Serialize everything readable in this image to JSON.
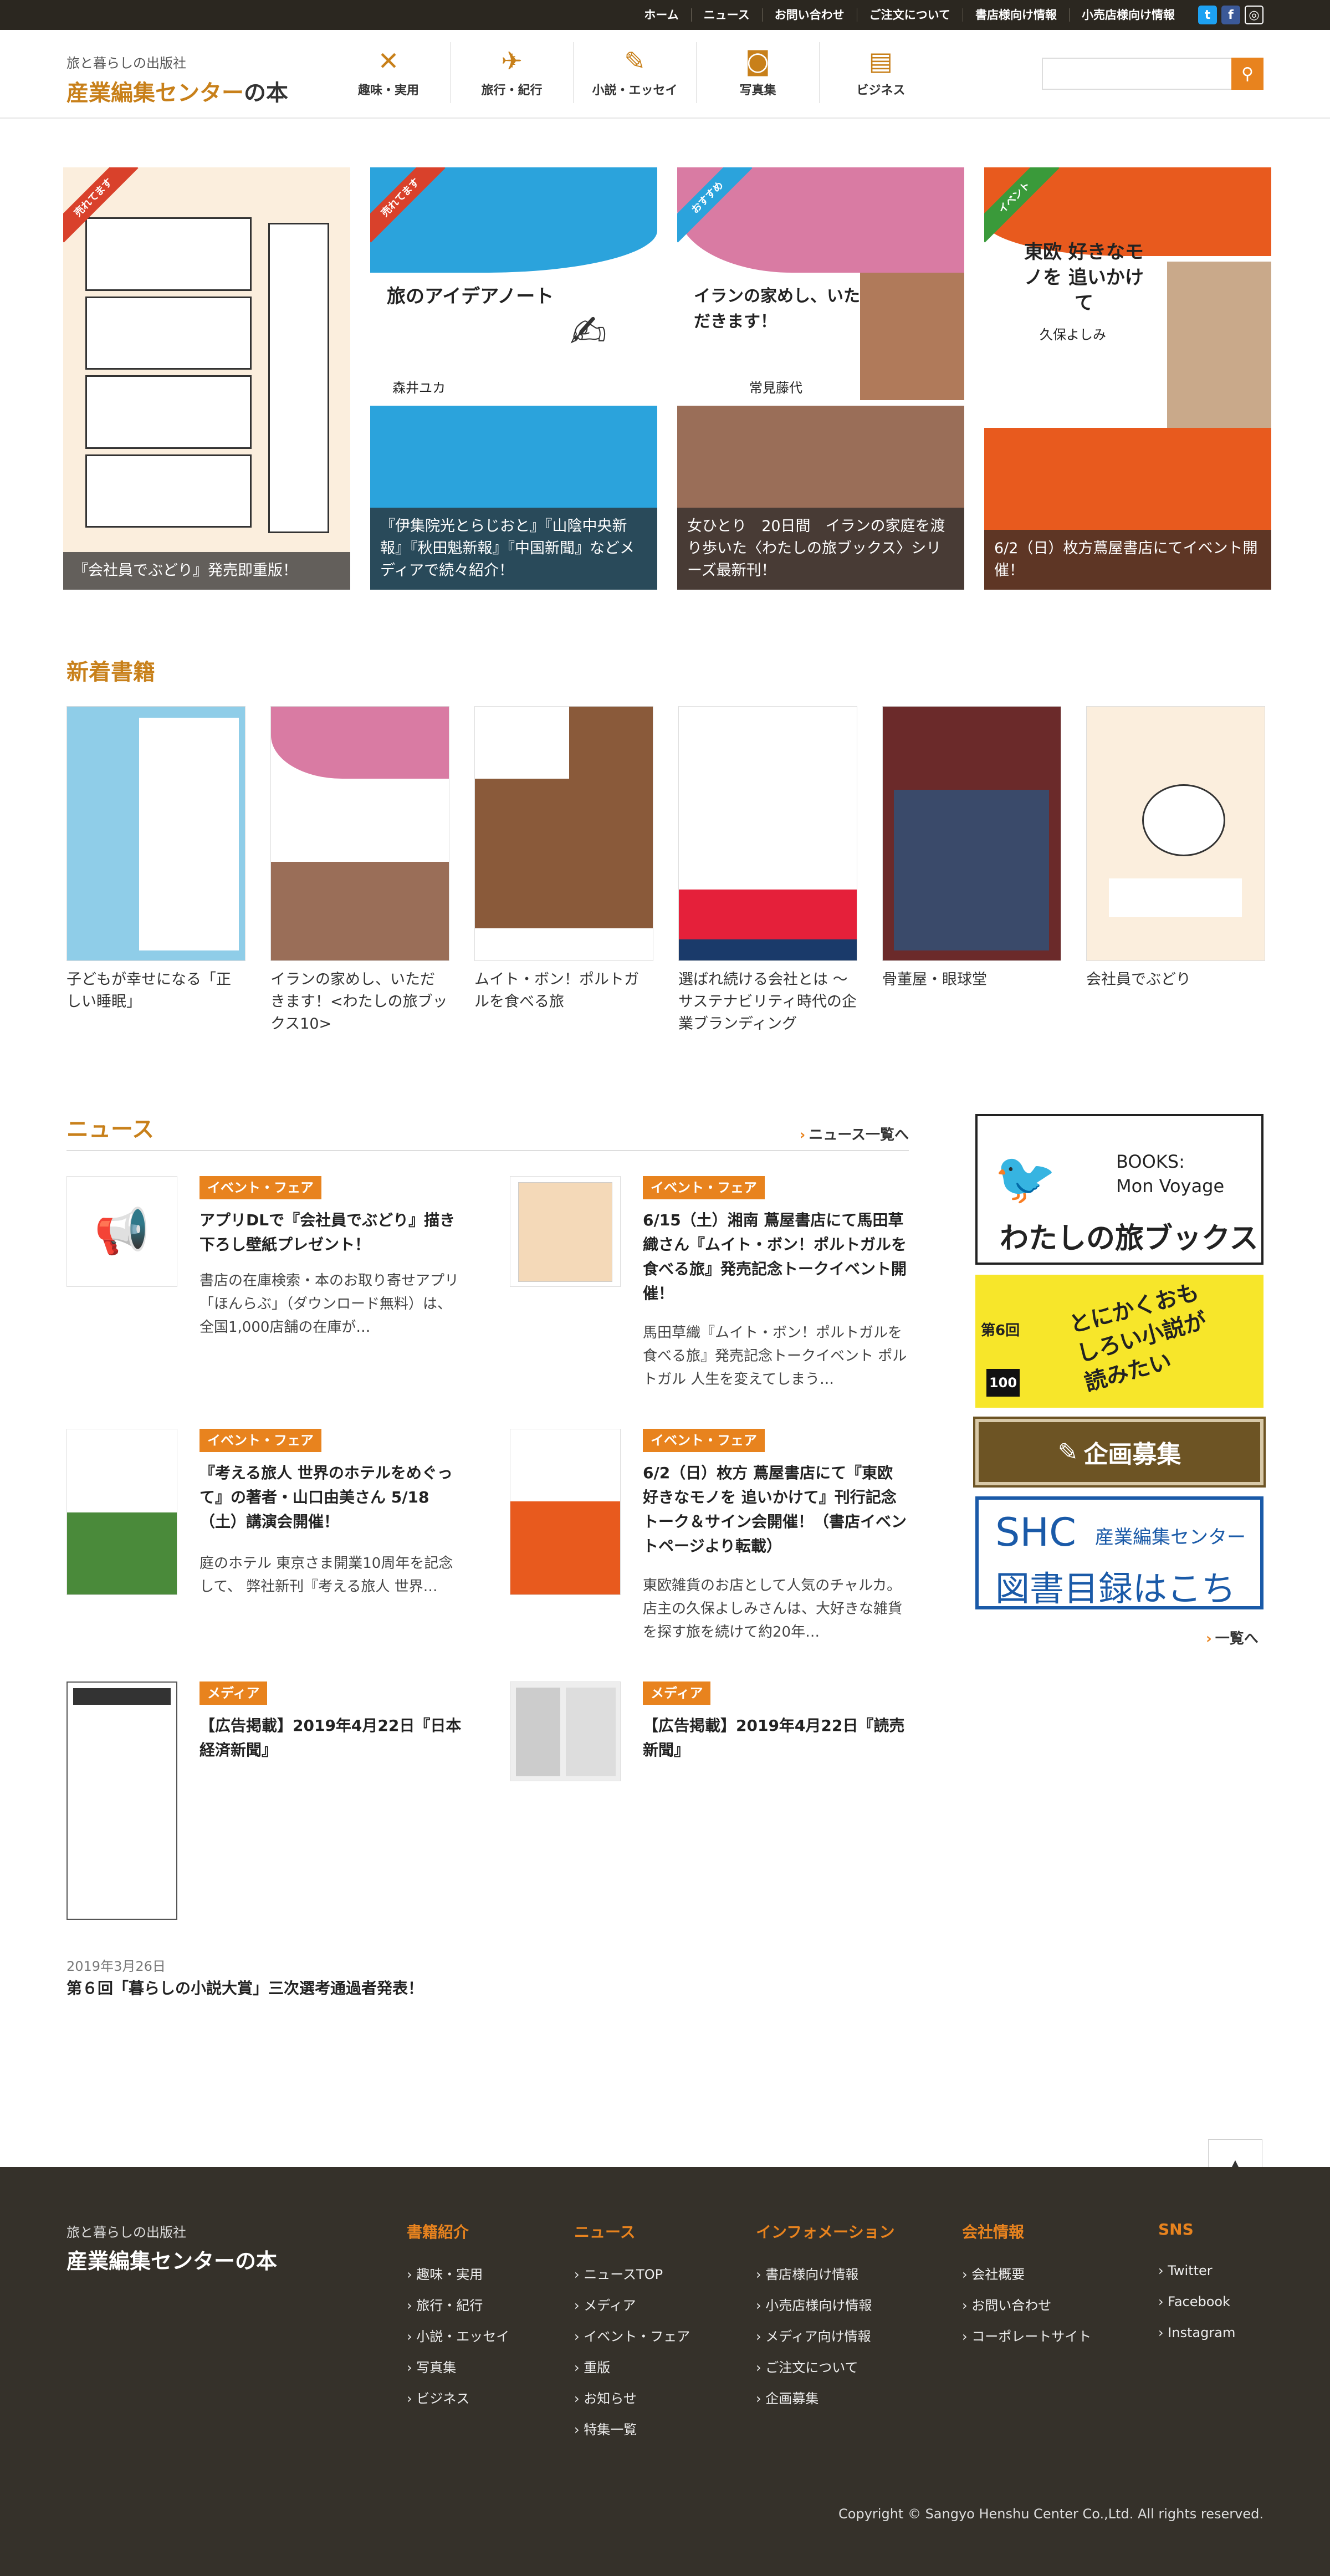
{
  "topbar": {
    "links": [
      "ホーム",
      "ニュース",
      "お問い合わせ",
      "ご注文について",
      "書店様向け情報",
      "小売店様向け情報"
    ],
    "social": [
      "twitter-icon",
      "facebook-icon",
      "instagram-icon"
    ]
  },
  "header": {
    "brand_sub": "旅と暮らしの出版社",
    "brand_main": "産業編集センター",
    "brand_suffix": "の本",
    "nav": [
      {
        "label": "趣味・実用",
        "icon": "utensils-icon"
      },
      {
        "label": "旅行・紀行",
        "icon": "airplane-icon"
      },
      {
        "label": "小説・エッセイ",
        "icon": "pencil-icon"
      },
      {
        "label": "写真集",
        "icon": "camera-icon"
      },
      {
        "label": "ビジネス",
        "icon": "notebook-icon"
      }
    ],
    "search_placeholder": ""
  },
  "hero": [
    {
      "ribbon": "売れてます",
      "ribbon_color": "#d9412b",
      "caption": "『会社員でぶどり』発売即重版！",
      "band": "#fbeedd",
      "cover_title": "",
      "cover_author": ""
    },
    {
      "ribbon": "売れてます",
      "ribbon_color": "#d9412b",
      "caption": "『伊集院光とらじおと』『山陰中央新報』『秋田魁新報』『中国新聞』などメディアで続々紹介！",
      "band": "#2ba3dc",
      "cover_title": "旅のアイデアノート",
      "cover_author": "森井ユカ"
    },
    {
      "ribbon": "おすすめ",
      "ribbon_color": "#2ba3dc",
      "caption": "女ひとり　20日間　イランの家庭を渡り歩いた〈わたしの旅ブックス〉シリーズ最新刊！",
      "band": "#d97ba3",
      "cover_title": "イランの家めし、いただきます！",
      "cover_author": "常見藤代"
    },
    {
      "ribbon": "イベント",
      "ribbon_color": "#3a9a3a",
      "caption": "6/2（日）枚方蔦屋書店にてイベント開催！",
      "band": "#e85a1e",
      "cover_title": "東欧 好きなモノを 追いかけて",
      "cover_author": "久保よしみ"
    }
  ],
  "new_books": {
    "title": "新着書籍",
    "items": [
      {
        "name": "子どもが幸せになる「正しい睡眠」",
        "bg": "#8fcde8"
      },
      {
        "name": "イランの家めし、いただきます！<わたしの旅ブックス10>",
        "bg": "#f2d9e3"
      },
      {
        "name": "ムイト・ボン！ポルトガルを食べる旅",
        "bg": "#8a5a3a"
      },
      {
        "name": "選ばれ続ける会社とは 〜サステナビリティ時代の企業ブランディング",
        "bg": "#ffffff"
      },
      {
        "name": "骨董屋・眼球堂",
        "bg": "#6b2a2a"
      },
      {
        "name": "会社員でぶどり",
        "bg": "#fbeedd"
      }
    ]
  },
  "news": {
    "title": "ニュース",
    "more": "ニュース一覧へ",
    "items": [
      {
        "tag": "イベント・フェア",
        "title": "アプリDLで『会社員でぶどり』描き下ろし壁紙プレゼント！",
        "excerpt": "書店の在庫検索・本のお取り寄せアプリ「ほんらぶ」（ダウンロード無料）は、 全国1,000店舗の在庫が…"
      },
      {
        "tag": "イベント・フェア",
        "title": "6/15（土）湘南 蔦屋書店にて馬田草織さん『ムイト・ボン！ポルトガルを食べる旅』発売記念トークイベント開催！",
        "excerpt": "馬田草織『ムイト・ボン！ポルトガルを食べる旅』発売記念トークイベント ポルトガル 人生を変えてしまう…"
      },
      {
        "tag": "イベント・フェア",
        "title": "『考える旅人 世界のホテルをめぐって』の著者・山口由美さん 5/18（土）講演会開催！",
        "excerpt": "庭のホテル 東京さま開業10周年を記念して、 弊社新刊『考える旅人 世界…"
      },
      {
        "tag": "イベント・フェア",
        "title": "6/2（日）枚方 蔦屋書店にて『東欧 好きなモノを 追いかけて』刊行記念トーク＆サイン会開催！（書店イベントページより転載）",
        "excerpt": "東欧雑貨のお店として人気のチャルカ。 店主の久保よしみさんは、大好きな雑貨を探す旅を続けて約20年…"
      },
      {
        "tag": "メディア",
        "title": "【広告掲載】2019年4月22日『日本経済新聞』",
        "excerpt": ""
      },
      {
        "tag": "メディア",
        "title": "【広告掲載】2019年4月22日『読売新聞』",
        "excerpt": ""
      }
    ],
    "latest_date": "2019年3月26日",
    "latest_title": "第６回「暮らしの小説大賞」三次選考通過者発表！"
  },
  "sidebar": {
    "banner1_small": "BOOKS:\nMon Voyage",
    "banner1_large": "わたしの旅ブックス",
    "banner2_text": "とにかくおもしろい小説が読みたい",
    "banner2_badge": "100",
    "banner2_prize": "第6回",
    "banner3_text": "企画募集",
    "banner4_logo": "SHC",
    "banner4_sub": "産業編集センター",
    "banner4_text": "図書目録はこちら",
    "more": "一覧へ"
  },
  "footer": {
    "brand_sub": "旅と暮らしの出版社",
    "brand_main": "産業編集センターの本",
    "columns": [
      {
        "heading": "書籍紹介",
        "links": [
          "趣味・実用",
          "旅行・紀行",
          "小説・エッセイ",
          "写真集",
          "ビジネス"
        ]
      },
      {
        "heading": "ニュース",
        "links": [
          "ニュースTOP",
          "メディア",
          "イベント・フェア",
          "重版",
          "お知らせ",
          "特集一覧"
        ]
      },
      {
        "heading": "インフォメーション",
        "links": [
          "書店様向け情報",
          "小売店様向け情報",
          "メディア向け情報",
          "ご注文について",
          "企画募集"
        ]
      },
      {
        "heading": "会社情報",
        "links": [
          "会社概要",
          "お問い合わせ",
          "コーポレートサイト"
        ]
      },
      {
        "heading": "SNS",
        "links": [
          "Twitter",
          "Facebook",
          "Instagram"
        ]
      }
    ],
    "copyright": "Copyright © Sangyo Henshu Center Co.,Ltd. All rights reserved."
  },
  "colors": {
    "accent": "#e8831e",
    "brand": "#c8801a",
    "footer_bg": "#35312a",
    "topbar_bg": "#2b2720"
  }
}
